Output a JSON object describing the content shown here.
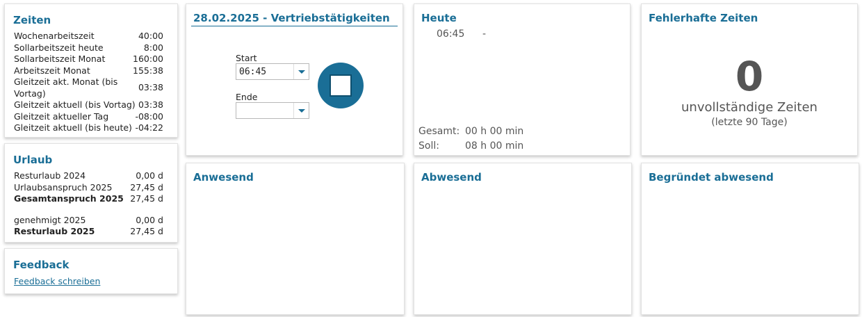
{
  "zeiten": {
    "title": "Zeiten",
    "rows": [
      {
        "label": "Wochenarbeitszeit",
        "value": "40:00"
      },
      {
        "label": "Sollarbeitszeit heute",
        "value": "8:00"
      },
      {
        "label": "Sollarbeitszeit Monat",
        "value": "160:00"
      },
      {
        "label": "Arbeitszeit Monat",
        "value": "155:38"
      },
      {
        "label": "Gleitzeit akt. Monat (bis Vortag)",
        "value": "03:38"
      },
      {
        "label": "Gleitzeit aktuell (bis Vortag)",
        "value": "03:38"
      },
      {
        "label": "Gleitzeit aktueller Tag",
        "value": "-08:00"
      },
      {
        "label": "Gleitzeit aktuell (bis heute)",
        "value": "-04:22"
      }
    ]
  },
  "urlaub": {
    "title": "Urlaub",
    "rows": [
      {
        "label": "Resturlaub 2024",
        "value": "0,00 d"
      },
      {
        "label": "Urlaubsanspruch 2025",
        "value": "27,45 d"
      },
      {
        "label": "Gesamtanspruch 2025",
        "value": "27,45 d"
      },
      {
        "label": "genehmigt 2025",
        "value": "0,00 d"
      },
      {
        "label": "Resturlaub 2025",
        "value": "27,45 d"
      }
    ]
  },
  "feedback": {
    "title": "Feedback",
    "link": "Feedback schreiben"
  },
  "vertrieb": {
    "title": "28.02.2025 - Vertriebstätigkeiten",
    "start_label": "Start",
    "start_value": "06:45",
    "ende_label": "Ende",
    "ende_value": ""
  },
  "heute": {
    "title": "Heute",
    "start_time": "06:45",
    "separator": "-",
    "gesamt_label": "Gesamt:",
    "gesamt_value": "00 h 00 min",
    "soll_label": "Soll:",
    "soll_value": "08 h 00 min"
  },
  "fehlerhaft": {
    "title": "Fehlerhafte Zeiten",
    "count": "0",
    "subtitle": "unvollständige Zeiten",
    "note": "(letzte 90 Tage)"
  },
  "anwesend": {
    "title": "Anwesend"
  },
  "abwesend": {
    "title": "Abwesend"
  },
  "begruendet": {
    "title": "Begründet abwesend"
  },
  "colors": {
    "accent": "#1a6e96",
    "text_muted": "#555555"
  },
  "icons": {
    "stop": "stop-icon",
    "dropdown": "chevron-down-icon"
  }
}
